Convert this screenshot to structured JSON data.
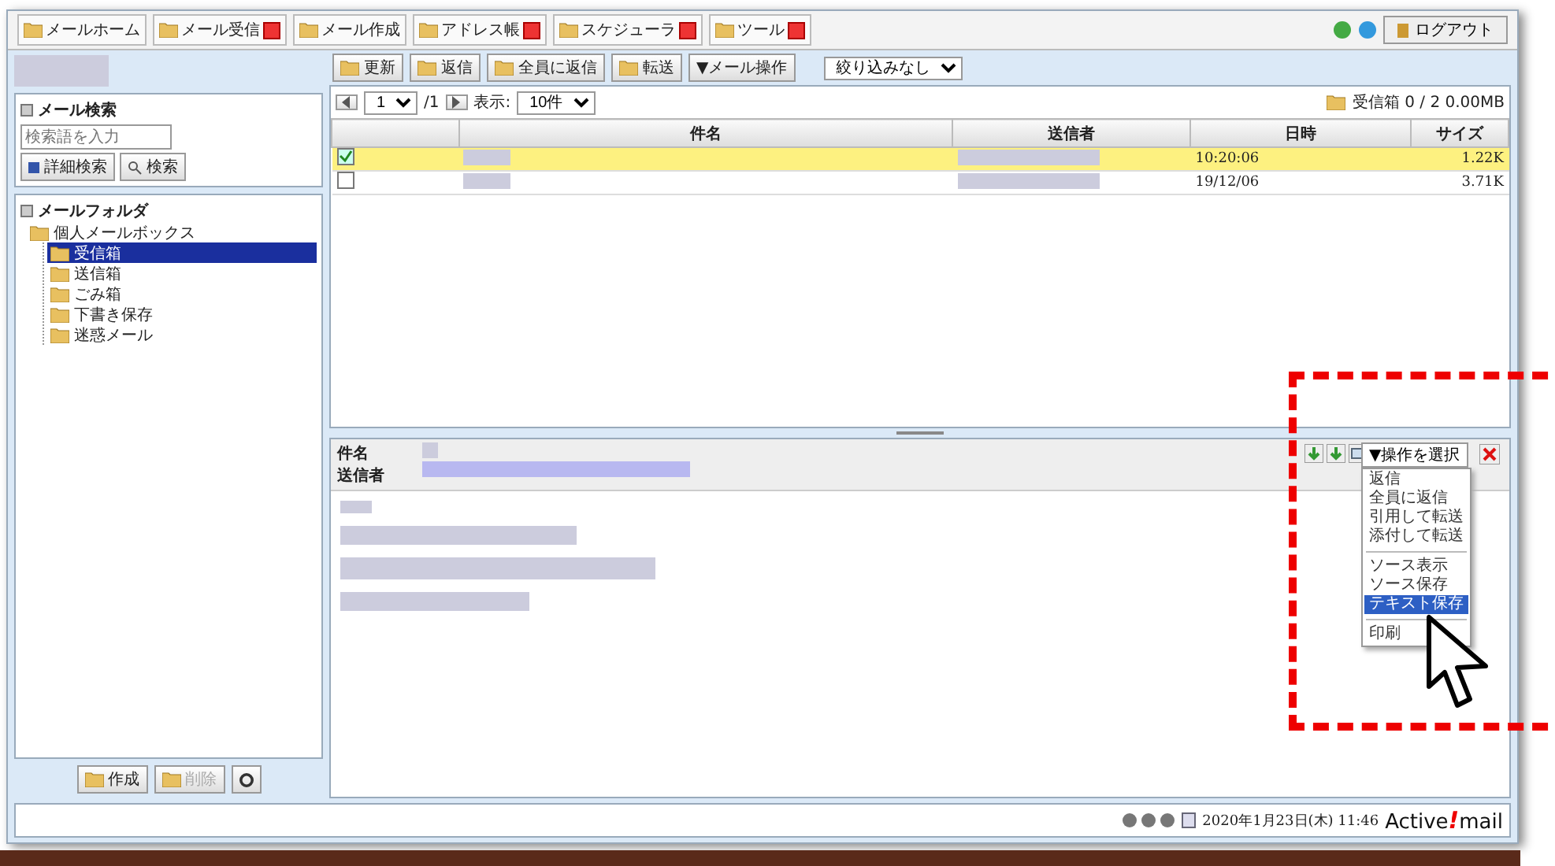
{
  "tabs": [
    {
      "label": "メールホーム",
      "dropdown": false
    },
    {
      "label": "メール受信",
      "dropdown": true
    },
    {
      "label": "メール作成",
      "dropdown": false
    },
    {
      "label": "アドレス帳",
      "dropdown": true
    },
    {
      "label": "スケジューラ",
      "dropdown": true
    },
    {
      "label": "ツール",
      "dropdown": true
    }
  ],
  "logout": "ログアウト",
  "toolbar": {
    "buttons": [
      "更新",
      "返信",
      "全員に返信",
      "転送"
    ],
    "menu": "▼メール操作",
    "filter": "絞り込みなし"
  },
  "search": {
    "title": "メール検索",
    "placeholder": "検索語を入力",
    "detail": "詳細検索",
    "button": "検索"
  },
  "folders": {
    "title": "メールフォルダ",
    "tree": [
      {
        "label": "個人メールボックス",
        "selected": false,
        "children": [
          {
            "label": "受信箱",
            "selected": true
          },
          {
            "label": "送信箱",
            "selected": false
          },
          {
            "label": "ごみ箱",
            "selected": false
          },
          {
            "label": "下書き保存",
            "selected": false
          },
          {
            "label": "迷惑メール",
            "selected": false
          }
        ]
      }
    ]
  },
  "folder_buttons": [
    {
      "label": "作成",
      "disabled": false
    },
    {
      "label": "削除",
      "disabled": true
    }
  ],
  "list": {
    "page": "1",
    "pages": "/1",
    "display_label": "表示:",
    "per_page": "10件",
    "folder_info": "受信箱 0 / 2 0.00MB",
    "columns": [
      "件名",
      "送信者",
      "日時",
      "サイズ"
    ],
    "rows": [
      {
        "checked": true,
        "selected": true,
        "date": "10:20:06",
        "size": "1.22K"
      },
      {
        "checked": false,
        "selected": false,
        "date": "19/12/06",
        "size": "3.71K"
      }
    ]
  },
  "preview": {
    "subject_label": "件名",
    "sender_label": "送信者",
    "menu": "▼操作を選択",
    "menu_items": [
      {
        "kind": "item",
        "label": "返信",
        "selected": false
      },
      {
        "kind": "item",
        "label": "全員に返信",
        "selected": false
      },
      {
        "kind": "item",
        "label": "引用して転送",
        "selected": false
      },
      {
        "kind": "item",
        "label": "添付して転送",
        "selected": false
      },
      {
        "kind": "separator"
      },
      {
        "kind": "item",
        "label": "ソース表示",
        "selected": false
      },
      {
        "kind": "item",
        "label": "ソース保存",
        "selected": false
      },
      {
        "kind": "item",
        "label": "テキスト保存",
        "selected": true
      },
      {
        "kind": "separator"
      },
      {
        "kind": "item",
        "label": "印刷",
        "selected": false
      }
    ]
  },
  "status": {
    "datetime": "2020年1月23日(木) 11:46",
    "logo": {
      "before": "Active",
      "mark": "!",
      "after": "mail"
    }
  }
}
